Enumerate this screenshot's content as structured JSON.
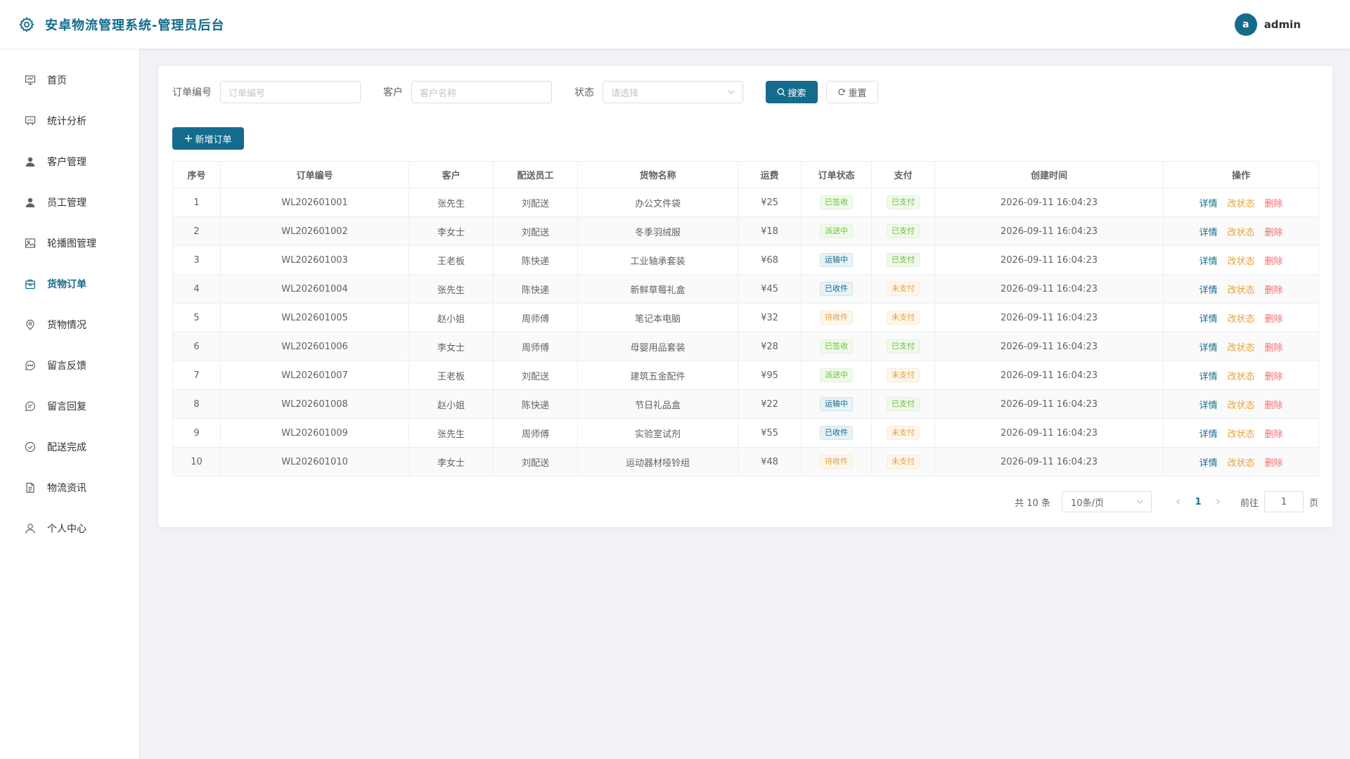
{
  "header": {
    "title": "安卓物流管理系统-管理员后台",
    "avatar_letter": "a",
    "username": "admin"
  },
  "sidebar": {
    "items": [
      {
        "label": "首页",
        "icon": "dashboard-icon"
      },
      {
        "label": "统计分析",
        "icon": "chart-board-icon"
      },
      {
        "label": "客户管理",
        "icon": "user-filled-icon"
      },
      {
        "label": "员工管理",
        "icon": "user-filled-icon"
      },
      {
        "label": "轮播图管理",
        "icon": "picture-icon"
      },
      {
        "label": "货物订单",
        "icon": "box-icon",
        "active": true
      },
      {
        "label": "货物情况",
        "icon": "location-icon"
      },
      {
        "label": "留言反馈",
        "icon": "chat-dots-icon"
      },
      {
        "label": "留言回复",
        "icon": "chat-line-icon"
      },
      {
        "label": "配送完成",
        "icon": "circle-check-icon"
      },
      {
        "label": "物流资讯",
        "icon": "document-icon"
      },
      {
        "label": "个人中心",
        "icon": "user-icon"
      }
    ]
  },
  "filters": {
    "order_no_label": "订单编号",
    "order_no_placeholder": "订单编号",
    "customer_label": "客户",
    "customer_placeholder": "客户名称",
    "status_label": "状态",
    "status_placeholder": "请选择",
    "search_label": "搜索",
    "reset_label": "重置"
  },
  "toolbar": {
    "add_label": "新增订单"
  },
  "table": {
    "columns": [
      "序号",
      "订单编号",
      "客户",
      "配送员工",
      "货物名称",
      "运费",
      "订单状态",
      "支付",
      "创建时间",
      "操作"
    ],
    "actions": {
      "detail": "详情",
      "status": "改状态",
      "delete": "删除"
    },
    "rows": [
      {
        "idx": "1",
        "order_no": "WL202601001",
        "customer": "张先生",
        "courier": "刘配送",
        "goods": "办公文件袋",
        "fee": "¥25",
        "status": "已签收",
        "pay": "已支付",
        "created": "2026-09-11 16:04:23"
      },
      {
        "idx": "2",
        "order_no": "WL202601002",
        "customer": "李女士",
        "courier": "刘配送",
        "goods": "冬季羽绒服",
        "fee": "¥18",
        "status": "派送中",
        "pay": "已支付",
        "created": "2026-09-11 16:04:23"
      },
      {
        "idx": "3",
        "order_no": "WL202601003",
        "customer": "王老板",
        "courier": "陈快递",
        "goods": "工业轴承套装",
        "fee": "¥68",
        "status": "运输中",
        "pay": "已支付",
        "created": "2026-09-11 16:04:23"
      },
      {
        "idx": "4",
        "order_no": "WL202601004",
        "customer": "张先生",
        "courier": "陈快递",
        "goods": "新鲜草莓礼盒",
        "fee": "¥45",
        "status": "已收件",
        "pay": "未支付",
        "created": "2026-09-11 16:04:23"
      },
      {
        "idx": "5",
        "order_no": "WL202601005",
        "customer": "赵小姐",
        "courier": "周师傅",
        "goods": "笔记本电脑",
        "fee": "¥32",
        "status": "待收件",
        "pay": "未支付",
        "created": "2026-09-11 16:04:23"
      },
      {
        "idx": "6",
        "order_no": "WL202601006",
        "customer": "李女士",
        "courier": "周师傅",
        "goods": "母婴用品套装",
        "fee": "¥28",
        "status": "已签收",
        "pay": "已支付",
        "created": "2026-09-11 16:04:23"
      },
      {
        "idx": "7",
        "order_no": "WL202601007",
        "customer": "王老板",
        "courier": "刘配送",
        "goods": "建筑五金配件",
        "fee": "¥95",
        "status": "派送中",
        "pay": "未支付",
        "created": "2026-09-11 16:04:23"
      },
      {
        "idx": "8",
        "order_no": "WL202601008",
        "customer": "赵小姐",
        "courier": "陈快递",
        "goods": "节日礼品盒",
        "fee": "¥22",
        "status": "运输中",
        "pay": "已支付",
        "created": "2026-09-11 16:04:23"
      },
      {
        "idx": "9",
        "order_no": "WL202601009",
        "customer": "张先生",
        "courier": "周师傅",
        "goods": "实验室试剂",
        "fee": "¥55",
        "status": "已收件",
        "pay": "未支付",
        "created": "2026-09-11 16:04:23"
      },
      {
        "idx": "10",
        "order_no": "WL202601010",
        "customer": "李女士",
        "courier": "刘配送",
        "goods": "运动器材哑铃组",
        "fee": "¥48",
        "status": "待收件",
        "pay": "未支付",
        "created": "2026-09-11 16:04:23"
      }
    ]
  },
  "pagination": {
    "total": "共 10 条",
    "page_size": "10条/页",
    "current_page": "1",
    "goto_label": "前往",
    "goto_value": "1",
    "page_suffix": "页"
  },
  "colors": {
    "accent": "#146c8c",
    "success": "#67c23a",
    "warning": "#e6a23c",
    "danger": "#f56c6c"
  }
}
